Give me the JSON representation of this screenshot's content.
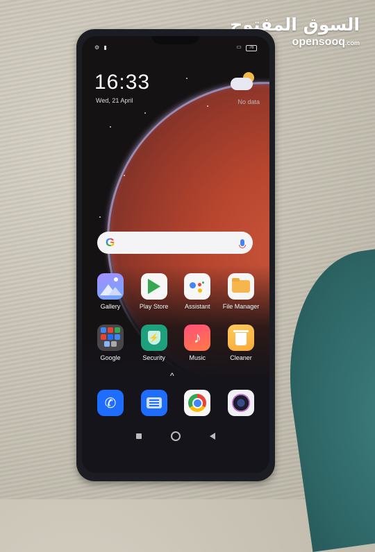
{
  "watermark": {
    "arabic": "السوق المفتوح",
    "brand": "opensooq",
    "suffix": ".com"
  },
  "status_bar": {
    "left_icons": [
      "gear-icon",
      "sim-icon"
    ],
    "right_icons": [
      "vibrate-icon",
      "battery-icon"
    ],
    "battery_label": "76"
  },
  "lock_widget": {
    "time": "16:33",
    "date": "Wed, 21 April",
    "weather_text": "No data"
  },
  "search_bar": {
    "logo": "G",
    "mic_icon": "mic-icon"
  },
  "apps_row1": [
    {
      "label": "Gallery",
      "icon": "gallery-icon"
    },
    {
      "label": "Play Store",
      "icon": "play-store-icon"
    },
    {
      "label": "Assistant",
      "icon": "assistant-icon"
    },
    {
      "label": "File Manager",
      "icon": "folder-icon"
    }
  ],
  "apps_row2": [
    {
      "label": "Google",
      "icon": "google-folder-icon"
    },
    {
      "label": "Security",
      "icon": "shield-icon"
    },
    {
      "label": "Music",
      "icon": "music-note-icon"
    },
    {
      "label": "Cleaner",
      "icon": "trash-icon"
    }
  ],
  "app_drawer_hint": "^",
  "dock": [
    {
      "name": "Phone",
      "icon": "phone-icon"
    },
    {
      "name": "Messages",
      "icon": "message-icon"
    },
    {
      "name": "Chrome",
      "icon": "chrome-icon"
    },
    {
      "name": "Camera",
      "icon": "camera-icon"
    }
  ],
  "glyphs": {
    "security": "⚡",
    "music": "♪",
    "phone": "✆"
  },
  "colors": {
    "dock_blue": "#1f6dff",
    "security_green": "#1fa07d",
    "mars_orange": "#b8462f"
  }
}
